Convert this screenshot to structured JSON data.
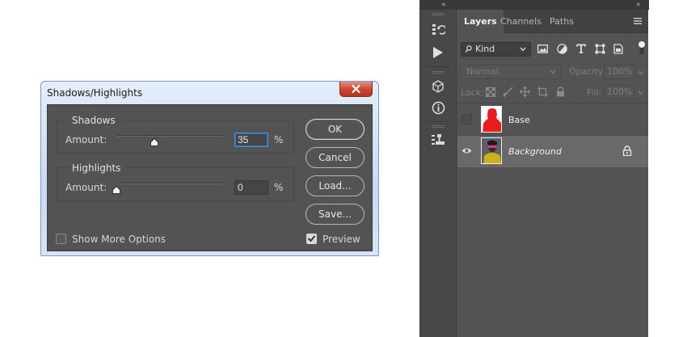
{
  "dialog": {
    "title": "Shadows/Highlights",
    "shadows": {
      "group_title": "Shadows",
      "amount_label": "Amount:",
      "value": "35",
      "unit": "%",
      "slider_fraction": 0.35
    },
    "highlights": {
      "group_title": "Highlights",
      "amount_label": "Amount:",
      "value": "0",
      "unit": "%",
      "slider_fraction": 0.0
    },
    "buttons": {
      "ok": "OK",
      "cancel": "Cancel",
      "load": "Load...",
      "save": "Save..."
    },
    "show_more_options": {
      "label": "Show More Options",
      "checked": false
    },
    "preview": {
      "label": "Preview",
      "checked": true
    }
  },
  "panel": {
    "collapse_glyph": "«",
    "expand_glyph": "»",
    "tabs": [
      "Layers",
      "Channels",
      "Paths"
    ],
    "active_tab": "Layers",
    "filter": {
      "kind": "Kind",
      "icons": [
        "image-filter-icon",
        "adjustment-filter-icon",
        "type-filter-icon",
        "shape-filter-icon",
        "smart-object-filter-icon"
      ]
    },
    "blend_mode": "Normal",
    "opacity_label": "Opacity:",
    "opacity_value": "100%",
    "lock_label": "Lock:",
    "fill_label": "Fill:",
    "fill_value": "100%",
    "layers": [
      {
        "name": "Base",
        "visible": false,
        "selected": false,
        "locked": false,
        "italic": false,
        "thumb_color": "#e81e1e"
      },
      {
        "name": "Background",
        "visible": true,
        "selected": true,
        "locked": true,
        "italic": true,
        "thumb_color": "#c9b21a"
      }
    ]
  },
  "colors": {
    "focus_blue": "#4a8fd9",
    "close_red": "#c9442f",
    "panel_bg": "#535353"
  }
}
